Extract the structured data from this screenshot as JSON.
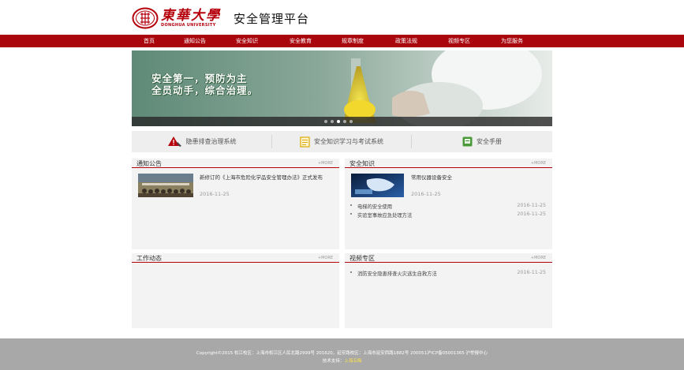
{
  "header": {
    "logo_cn": "東華大學",
    "logo_en": "DONGHUA UNIVERSITY",
    "platform_title": "安全管理平台"
  },
  "nav": {
    "items": [
      {
        "label": "首页"
      },
      {
        "label": "通知公告"
      },
      {
        "label": "安全知识"
      },
      {
        "label": "安全教育"
      },
      {
        "label": "规章制度"
      },
      {
        "label": "政策法规"
      },
      {
        "label": "视频专区"
      },
      {
        "label": "为您服务"
      }
    ]
  },
  "banner": {
    "slogan_line1": "安全第一，预防为主",
    "slogan_line2": "全员动手，综合治理。",
    "slide_count": 5,
    "active_slide": 2
  },
  "systems": {
    "items": [
      {
        "label": "隐患排查治理系统",
        "icon": "warning-triangle-icon"
      },
      {
        "label": "安全知识学习与考试系统",
        "icon": "document-list-icon"
      },
      {
        "label": "安全手册",
        "icon": "book-icon"
      }
    ]
  },
  "panels": {
    "notices": {
      "title": "通知公告",
      "more": "+MORE",
      "featured": {
        "title": "新修订的《上海市危险化学品安全管理办法》正式发布",
        "date": "2016-11-25"
      }
    },
    "knowledge": {
      "title": "安全知识",
      "more": "+MORE",
      "featured": {
        "title": "常用仪器设备安全",
        "date": "2016-11-25"
      },
      "list": [
        {
          "text": "电梯的安全使用",
          "date": "2016-11-25"
        },
        {
          "text": "实验室事故应急处理方法",
          "date": "2016-11-25"
        }
      ]
    },
    "work": {
      "title": "工作动态",
      "more": "+MORE"
    },
    "video": {
      "title": "视频专区",
      "more": "+MORE",
      "list": [
        {
          "text": "消防安全隐患排查火灾逃生自救方法",
          "date": "2016-11-25"
        }
      ]
    }
  },
  "footer": {
    "line1": "Copyright©2015 松江校区：上海市松江区人民北路2999号 201620，延安路校区：上海市延安西路1882号 200051沪ICP备05001365 沪举报中心",
    "line2_prefix": "技术支持：",
    "line2_vendor": "上海五梅"
  },
  "colors": {
    "brand_red": "#a9060e",
    "footer_gray": "#a8a8a8",
    "panel_bg": "#f3f3f3"
  }
}
